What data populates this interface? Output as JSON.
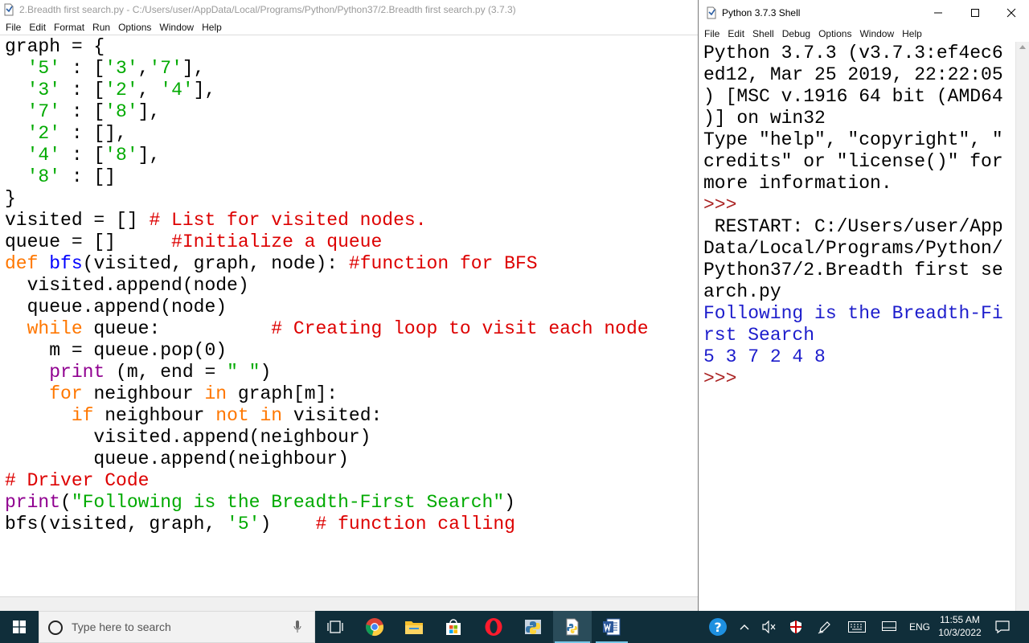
{
  "editor": {
    "title": "2.Breadth first search.py - C:/Users/user/AppData/Local/Programs/Python/Python37/2.Breadth first search.py (3.7.3)",
    "menu": [
      "File",
      "Edit",
      "Format",
      "Run",
      "Options",
      "Window",
      "Help"
    ],
    "code": [
      [
        [
          "t",
          "graph = {"
        ]
      ],
      [
        [
          "t",
          "  "
        ],
        [
          "s",
          "'5'"
        ],
        [
          "t",
          " : ["
        ],
        [
          "s",
          "'3'"
        ],
        [
          "t",
          ","
        ],
        [
          "s",
          "'7'"
        ],
        [
          "t",
          "],"
        ]
      ],
      [
        [
          "t",
          "  "
        ],
        [
          "s",
          "'3'"
        ],
        [
          "t",
          " : ["
        ],
        [
          "s",
          "'2'"
        ],
        [
          "t",
          ", "
        ],
        [
          "s",
          "'4'"
        ],
        [
          "t",
          "],"
        ]
      ],
      [
        [
          "t",
          "  "
        ],
        [
          "s",
          "'7'"
        ],
        [
          "t",
          " : ["
        ],
        [
          "s",
          "'8'"
        ],
        [
          "t",
          "],"
        ]
      ],
      [
        [
          "t",
          "  "
        ],
        [
          "s",
          "'2'"
        ],
        [
          "t",
          " : [],"
        ]
      ],
      [
        [
          "t",
          "  "
        ],
        [
          "s",
          "'4'"
        ],
        [
          "t",
          " : ["
        ],
        [
          "s",
          "'8'"
        ],
        [
          "t",
          "],"
        ]
      ],
      [
        [
          "t",
          "  "
        ],
        [
          "s",
          "'8'"
        ],
        [
          "t",
          " : []"
        ]
      ],
      [
        [
          "t",
          "}"
        ]
      ],
      [
        [
          "t",
          "visited = [] "
        ],
        [
          "c",
          "# List for visited nodes."
        ]
      ],
      [
        [
          "t",
          "queue = []     "
        ],
        [
          "c",
          "#Initialize a queue"
        ]
      ],
      [
        [
          "k",
          "def"
        ],
        [
          "t",
          " "
        ],
        [
          "f",
          "bfs"
        ],
        [
          "t",
          "(visited, graph, node): "
        ],
        [
          "c",
          "#function for BFS"
        ]
      ],
      [
        [
          "t",
          "  visited.append(node)"
        ]
      ],
      [
        [
          "t",
          "  queue.append(node)"
        ]
      ],
      [
        [
          "t",
          "  "
        ],
        [
          "k",
          "while"
        ],
        [
          "t",
          " queue:          "
        ],
        [
          "c",
          "# Creating loop to visit each node"
        ]
      ],
      [
        [
          "t",
          "    m = queue.pop(0)"
        ]
      ],
      [
        [
          "t",
          "    "
        ],
        [
          "b",
          "print"
        ],
        [
          "t",
          " (m, end = "
        ],
        [
          "s",
          "\" \""
        ],
        [
          "t",
          ")"
        ]
      ],
      [
        [
          "t",
          "    "
        ],
        [
          "k",
          "for"
        ],
        [
          "t",
          " neighbour "
        ],
        [
          "k",
          "in"
        ],
        [
          "t",
          " graph[m]:"
        ]
      ],
      [
        [
          "t",
          "      "
        ],
        [
          "k",
          "if"
        ],
        [
          "t",
          " neighbour "
        ],
        [
          "k",
          "not"
        ],
        [
          "t",
          " "
        ],
        [
          "k",
          "in"
        ],
        [
          "t",
          " visited:"
        ]
      ],
      [
        [
          "t",
          "        visited.append(neighbour)"
        ]
      ],
      [
        [
          "t",
          "        queue.append(neighbour)"
        ]
      ],
      [
        [
          "c",
          "# Driver Code"
        ]
      ],
      [
        [
          "b",
          "print"
        ],
        [
          "t",
          "("
        ],
        [
          "s",
          "\"Following is the Breadth-First Search\""
        ],
        [
          "t",
          ")"
        ]
      ],
      [
        [
          "t",
          "bfs(visited, graph, "
        ],
        [
          "s",
          "'5'"
        ],
        [
          "t",
          ")    "
        ],
        [
          "c",
          "# function calling"
        ]
      ]
    ]
  },
  "shell": {
    "title": "Python 3.7.3 Shell",
    "menu": [
      "File",
      "Edit",
      "Shell",
      "Debug",
      "Options",
      "Window",
      "Help"
    ],
    "lines": [
      [
        [
          "t",
          "Python 3.7.3 (v3.7.3:ef4ec6"
        ]
      ],
      [
        [
          "t",
          "ed12, Mar 25 2019, 22:22:05"
        ]
      ],
      [
        [
          "t",
          ") [MSC v.1916 64 bit (AMD64"
        ]
      ],
      [
        [
          "t",
          ")] on win32"
        ]
      ],
      [
        [
          "t",
          "Type \"help\", \"copyright\", \""
        ]
      ],
      [
        [
          "t",
          "credits\" or \"license()\" for"
        ]
      ],
      [
        [
          "t",
          "more information."
        ]
      ],
      [
        [
          "p",
          ">>> "
        ]
      ],
      [
        [
          "t",
          " RESTART: C:/Users/user/App"
        ]
      ],
      [
        [
          "t",
          "Data/Local/Programs/Python/"
        ]
      ],
      [
        [
          "t",
          "Python37/2.Breadth first se"
        ]
      ],
      [
        [
          "t",
          "arch.py"
        ]
      ],
      [
        [
          "o",
          "Following is the Breadth-Fi"
        ]
      ],
      [
        [
          "o",
          "rst Search"
        ]
      ],
      [
        [
          "o",
          "5 3 7 2 4 8"
        ]
      ],
      [
        [
          "p",
          ">>> "
        ]
      ]
    ]
  },
  "taskbar": {
    "search_placeholder": "Type here to search",
    "language": "ENG",
    "time": "11:55 AM",
    "date": "10/3/2022",
    "apps": [
      "chrome-icon",
      "file-explorer-icon",
      "store-icon",
      "opera-icon",
      "python-icon",
      "idle-icon",
      "word-icon"
    ]
  },
  "colors": {
    "keyword": "#ff7700",
    "builtin": "#900090",
    "string": "#00aa00",
    "comment": "#dd0000",
    "definition": "#0000ff",
    "shell_output": "#1d1dcc",
    "prompt": "#aa2222",
    "taskbar": "#102e3a"
  }
}
